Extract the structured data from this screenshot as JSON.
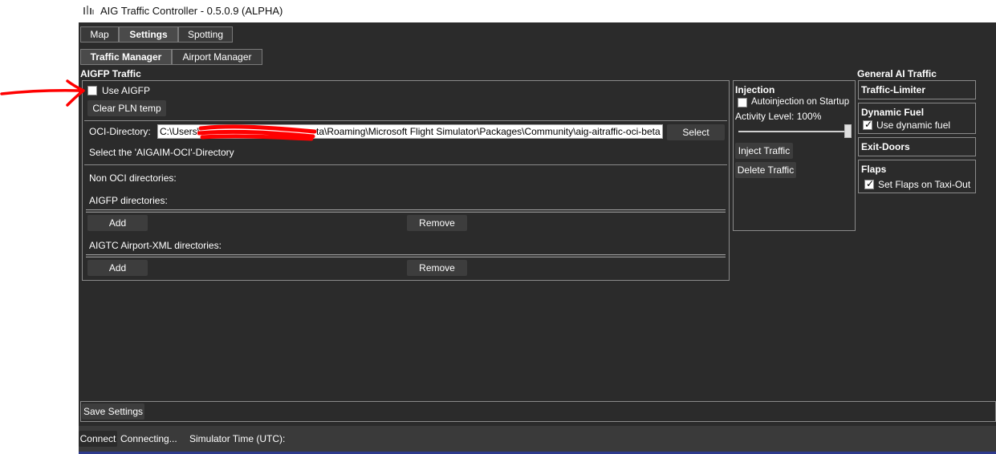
{
  "window": {
    "title": "AIG Traffic Controller - 0.5.0.9 (ALPHA)"
  },
  "main_tabs": [
    {
      "label": "Map"
    },
    {
      "label": "Settings"
    },
    {
      "label": "Spotting"
    }
  ],
  "sub_tabs": [
    {
      "label": "Traffic Manager"
    },
    {
      "label": "Airport Manager"
    }
  ],
  "aigfp": {
    "heading": "AIGFP Traffic",
    "use_aigfp_label": "Use AIGFP",
    "use_aigfp_checked": false,
    "clear_pln_label": "Clear PLN temp",
    "oci_label": "OCI-Directory:",
    "oci_value_start": "C:\\Users\\",
    "oci_value_end": "ta\\Roaming\\Microsoft Flight Simulator\\Packages\\Community\\aig-aitraffic-oci-beta",
    "select_label": "Select",
    "oci_hint": "Select the 'AIGAIM-OCI'-Directory",
    "non_oci_label": "Non OCI directories:",
    "aigfp_dirs_label": "AIGFP directories:",
    "add_label": "Add",
    "remove_label": "Remove",
    "airport_xml_label": "AIGTC Airport-XML directories:",
    "add_label_2": "Add",
    "remove_label_2": "Remove"
  },
  "injection": {
    "heading": "Injection",
    "autoinjection_label": "Autoinjection on Startup",
    "autoinjection_checked": false,
    "activity_label": "Activity Level: 100%",
    "activity_level": 1.0,
    "inject_label": "Inject Traffic",
    "delete_label": "Delete Traffic"
  },
  "general": {
    "heading": "General AI Traffic",
    "traffic_limiter": "Traffic-Limiter",
    "dynamic_fuel": "Dynamic Fuel",
    "use_dynamic_fuel": "Use dynamic fuel",
    "use_dynamic_fuel_checked": true,
    "exit_doors": "Exit-Doors",
    "flaps": "Flaps",
    "set_flaps": "Set Flaps on Taxi-Out",
    "set_flaps_checked": true
  },
  "save_label": "Save Settings",
  "status": {
    "connect_label": "Connect",
    "connecting_text": "Connecting...",
    "sim_time_label": "Simulator Time (UTC):"
  },
  "colors": {
    "background": "#2b2b2b",
    "annotation": "#ff0000",
    "footer": "#2e3a8c"
  }
}
